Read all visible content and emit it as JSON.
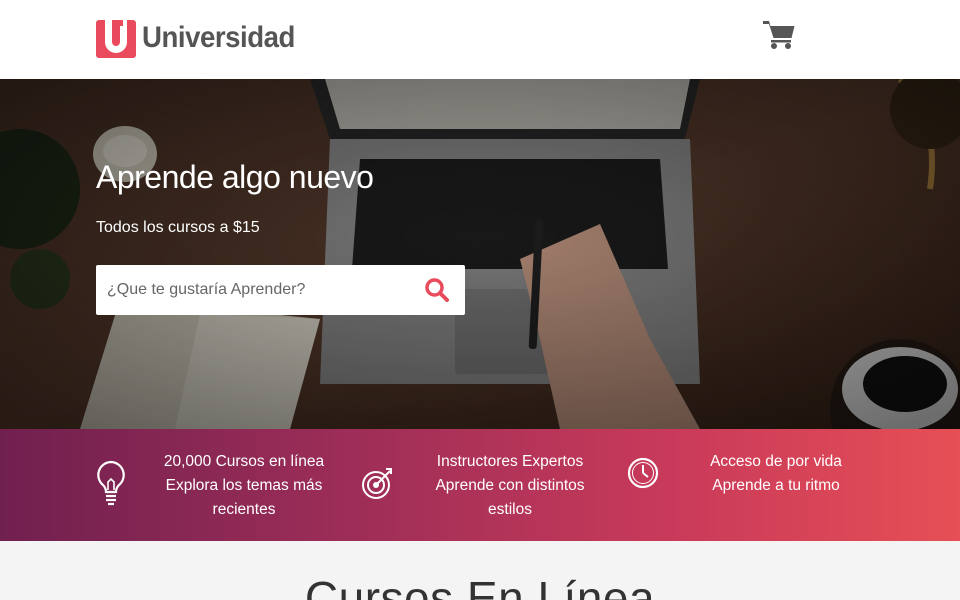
{
  "header": {
    "brand_text": "Universidad",
    "brand_color": "#e94b5c",
    "icons": {
      "logo": "u-logo-icon",
      "cart": "shopping-cart-icon"
    }
  },
  "hero": {
    "title": "Aprende algo nuevo",
    "subtitle": "Todos los cursos a $15",
    "search": {
      "placeholder": "¿Que te gustaría Aprender?",
      "value": "",
      "icon": "search-icon",
      "icon_color": "#e94b5c"
    }
  },
  "features": [
    {
      "icon": "lightbulb-icon",
      "line1": "20,000 Cursos en línea",
      "line2": "Explora los temas más",
      "line3": "recientes"
    },
    {
      "icon": "target-icon",
      "line1": "Instructores Expertos",
      "line2": "Aprende con distintos",
      "line3": "estilos"
    },
    {
      "icon": "clock-icon",
      "line1": "Acceso de por vida",
      "line2": "Aprende a tu ritmo",
      "line3": ""
    }
  ],
  "courses": {
    "title": "Cursos En Línea"
  },
  "colors": {
    "band_start": "#70204f",
    "band_end": "#e64f55",
    "accent": "#e94b5c"
  }
}
